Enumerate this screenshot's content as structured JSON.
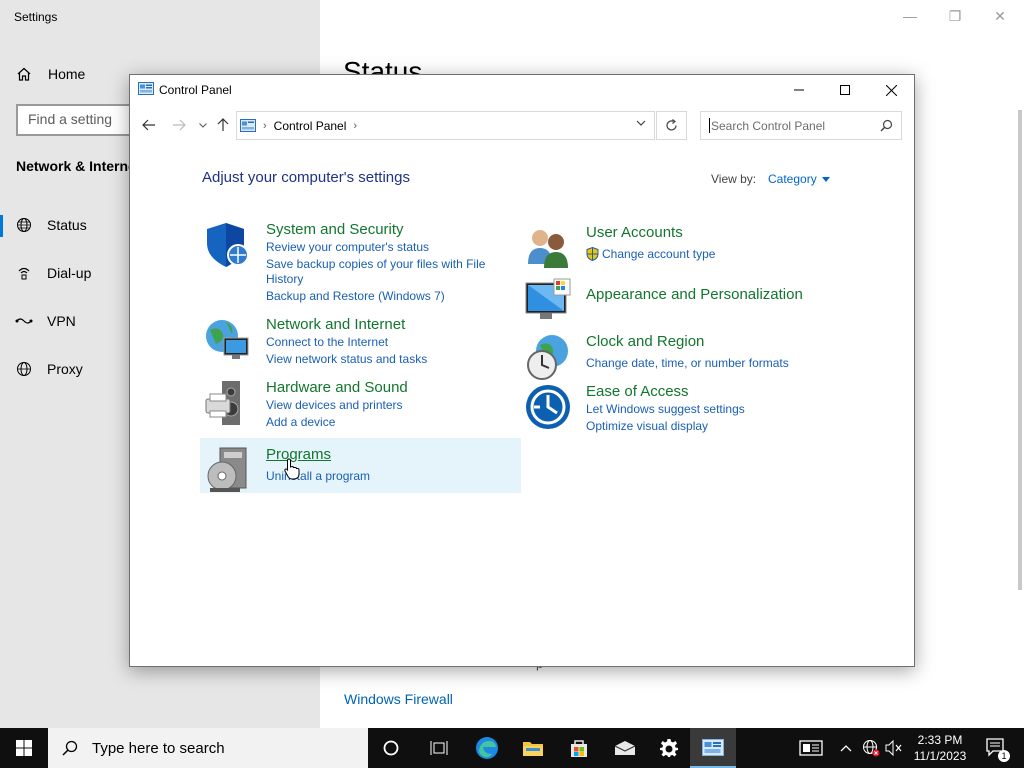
{
  "settings": {
    "title": "Settings",
    "home": "Home",
    "search_placeholder": "Find a setting",
    "section": "Network & Internet",
    "nav": [
      {
        "label": "Status",
        "icon": "globe-icon"
      },
      {
        "label": "Dial-up",
        "icon": "dialup-icon"
      },
      {
        "label": "VPN",
        "icon": "vpn-icon"
      },
      {
        "label": "Proxy",
        "icon": "globe-icon"
      }
    ],
    "page_title": "Status",
    "partial_text": "p",
    "firewall_link": "Windows Firewall"
  },
  "control_panel": {
    "title": "Control Panel",
    "breadcrumb": "Control Panel",
    "search_placeholder": "Search Control Panel",
    "heading": "Adjust your computer's settings",
    "view_by_label": "View by:",
    "view_by_value": "Category",
    "categories": [
      {
        "title": "System and Security",
        "links": [
          "Review your computer's status",
          "Save backup copies of your files with File",
          "History",
          "Backup and Restore (Windows 7)"
        ]
      },
      {
        "title": "Network and Internet",
        "links": [
          "Connect to the Internet",
          "View network status and tasks"
        ]
      },
      {
        "title": "Hardware and Sound",
        "links": [
          "View devices and printers",
          "Add a device"
        ]
      },
      {
        "title": "Programs",
        "links": [
          "Uninstall a program"
        ]
      },
      {
        "title": "User Accounts",
        "links": [
          "Change account type"
        ]
      },
      {
        "title": "Appearance and Personalization",
        "links": []
      },
      {
        "title": "Clock and Region",
        "links": [
          "Change date, time, or number formats"
        ]
      },
      {
        "title": "Ease of Access",
        "links": [
          "Let Windows suggest settings",
          "Optimize visual display"
        ]
      }
    ]
  },
  "taskbar": {
    "search_placeholder": "Type here to search",
    "time": "2:33 PM",
    "date": "11/1/2023",
    "notification_count": "1"
  }
}
